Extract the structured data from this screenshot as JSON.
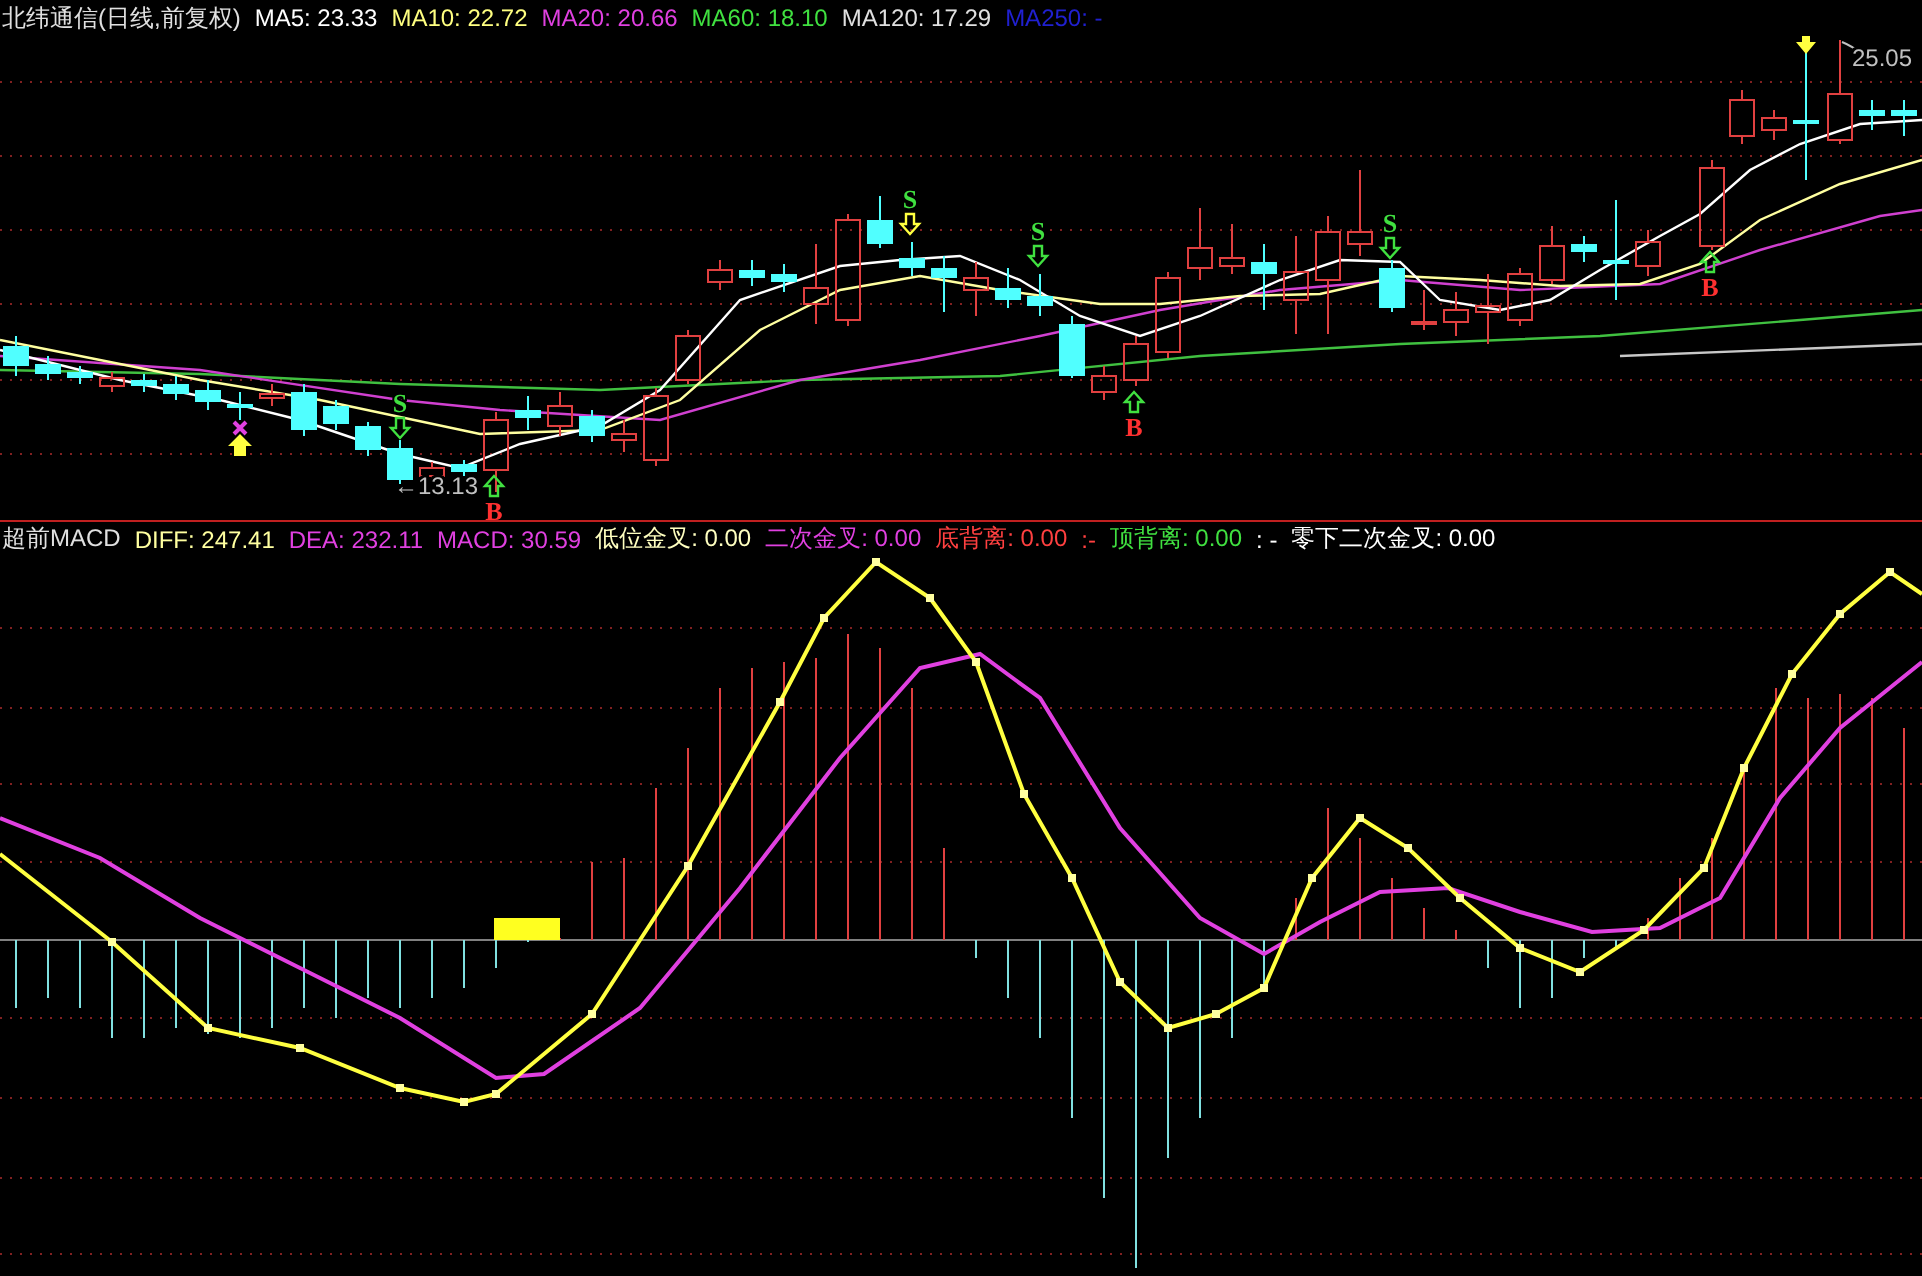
{
  "price_header": {
    "title": "北纬通信(日线,前复权)",
    "indicators": [
      {
        "label": "MA5: 23.33",
        "color": "#ffffff"
      },
      {
        "label": "MA10: 22.72",
        "color": "#ffff80"
      },
      {
        "label": "MA20: 20.66",
        "color": "#e040e0"
      },
      {
        "label": "MA60: 18.10",
        "color": "#40e040"
      },
      {
        "label": "MA120: 17.29",
        "color": "#e0e0e0"
      },
      {
        "label": "MA250: -",
        "color": "#2020d0"
      }
    ]
  },
  "price_chart": {
    "price_labels": [
      "25.05",
      "←13.13"
    ],
    "signals": [
      {
        "kind": "sell",
        "text": "S"
      },
      {
        "kind": "sell",
        "text": "S"
      },
      {
        "kind": "sell",
        "text": "S"
      },
      {
        "kind": "sell",
        "text": "S"
      },
      {
        "kind": "buy",
        "text": "B"
      },
      {
        "kind": "buy",
        "text": "B"
      },
      {
        "kind": "buy",
        "text": "B"
      }
    ]
  },
  "macd_header": {
    "title": "超前MACD",
    "indicators": [
      {
        "label": "DIFF: 247.41",
        "color": "#ffffa0"
      },
      {
        "label": "DEA: 232.11",
        "color": "#e040e0"
      },
      {
        "label": "MACD: 30.59",
        "color": "#e040e0"
      },
      {
        "label": "低位金叉: 0.00",
        "color": "#ffffc0"
      },
      {
        "label": "二次金叉: 0.00",
        "color": "#e040e0"
      },
      {
        "label": "底背离: 0.00",
        "color": "#ff4040"
      },
      {
        "label": ":-",
        "color": "#ff4040"
      },
      {
        "label": "顶背离: 0.00",
        "color": "#40e040"
      },
      {
        "label": ": -",
        "color": "#ffffff"
      },
      {
        "label": "零下二次金叉: 0.00",
        "color": "#ffffff"
      }
    ]
  }
}
